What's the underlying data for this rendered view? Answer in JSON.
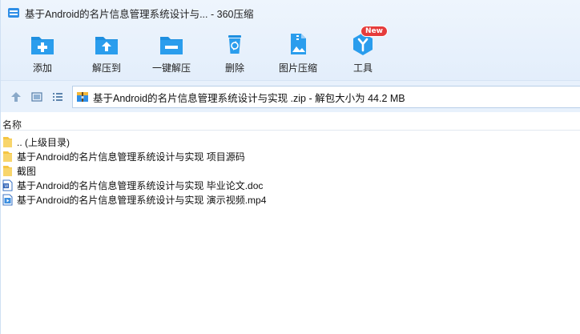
{
  "window": {
    "title": "基于Android的名片信息管理系统设计与...  - 360压缩"
  },
  "toolbar": {
    "items": [
      {
        "label": "添加",
        "icon": "add-icon"
      },
      {
        "label": "解压到",
        "icon": "extract-to-icon"
      },
      {
        "label": "一键解压",
        "icon": "one-click-extract-icon"
      },
      {
        "label": "删除",
        "icon": "delete-icon"
      },
      {
        "label": "图片压缩",
        "icon": "image-compress-icon"
      },
      {
        "label": "工具",
        "icon": "tools-icon",
        "badge": "New"
      }
    ]
  },
  "nav": {
    "address": "基于Android的名片信息管理系统设计与实现 .zip - 解包大小为 44.2 MB"
  },
  "list": {
    "column_name": "名称",
    "items": [
      {
        "name": ".. (上级目录)",
        "type": "parent-folder"
      },
      {
        "name": "基于Android的名片信息管理系统设计与实现 项目源码",
        "type": "folder"
      },
      {
        "name": "截图",
        "type": "folder"
      },
      {
        "name": "基于Android的名片信息管理系统设计与实现 毕业论文.doc",
        "type": "doc"
      },
      {
        "name": "基于Android的名片信息管理系统设计与实现 演示视频.mp4",
        "type": "video"
      }
    ]
  },
  "colors": {
    "accent": "#1e8fe0",
    "toolbar_bg": "#e6f0fc",
    "folder": "#f5c542",
    "badge": "#e53c3c"
  }
}
